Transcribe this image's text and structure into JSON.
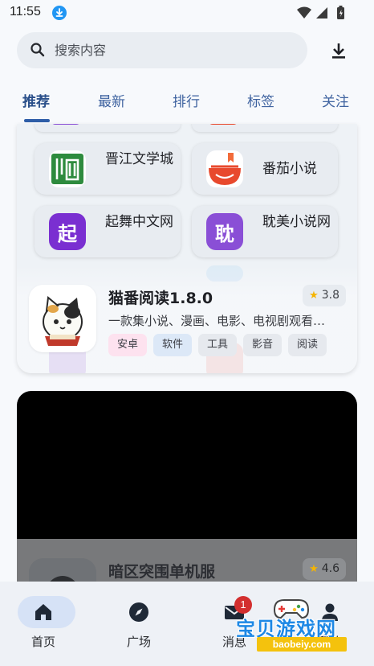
{
  "status_bar": {
    "time": "11:55"
  },
  "search": {
    "placeholder": "搜索内容"
  },
  "tabs": [
    {
      "label": "推荐",
      "active": true
    },
    {
      "label": "最新"
    },
    {
      "label": "排行"
    },
    {
      "label": "标签"
    },
    {
      "label": "关注"
    }
  ],
  "sources": [
    {
      "label": "晋江文学城",
      "icon": "jinjiang-logo-icon",
      "color": "#2e8b3e"
    },
    {
      "label": "番茄小说",
      "icon": "tomato-logo-icon",
      "color": "#e8492d"
    },
    {
      "label": "起舞中文网",
      "icon": "qi-logo-icon",
      "glyph": "起",
      "color": "#7a2fd1"
    },
    {
      "label": "耽美小说网",
      "icon": "dan-logo-icon",
      "glyph": "耽",
      "color": "#8a4fd6"
    }
  ],
  "featured_app": {
    "name": "猫番阅读1.8.0",
    "rating": "3.8",
    "description": "一款集小说、漫画、电影、电视剧观看…",
    "tags": [
      "安卓",
      "软件",
      "工具",
      "影音",
      "阅读"
    ]
  },
  "second_app": {
    "name": "暗区突围单机服",
    "rating": "4.6"
  },
  "bottom_nav": [
    {
      "label": "首页",
      "icon": "home-icon",
      "active": true
    },
    {
      "label": "广场",
      "icon": "compass-icon"
    },
    {
      "label": "消息",
      "icon": "mail-icon",
      "badge": "1"
    },
    {
      "label": "我的",
      "icon": "profile-icon"
    }
  ],
  "watermark": {
    "text": "宝贝游戏网",
    "url": "baobeiy.com"
  }
}
